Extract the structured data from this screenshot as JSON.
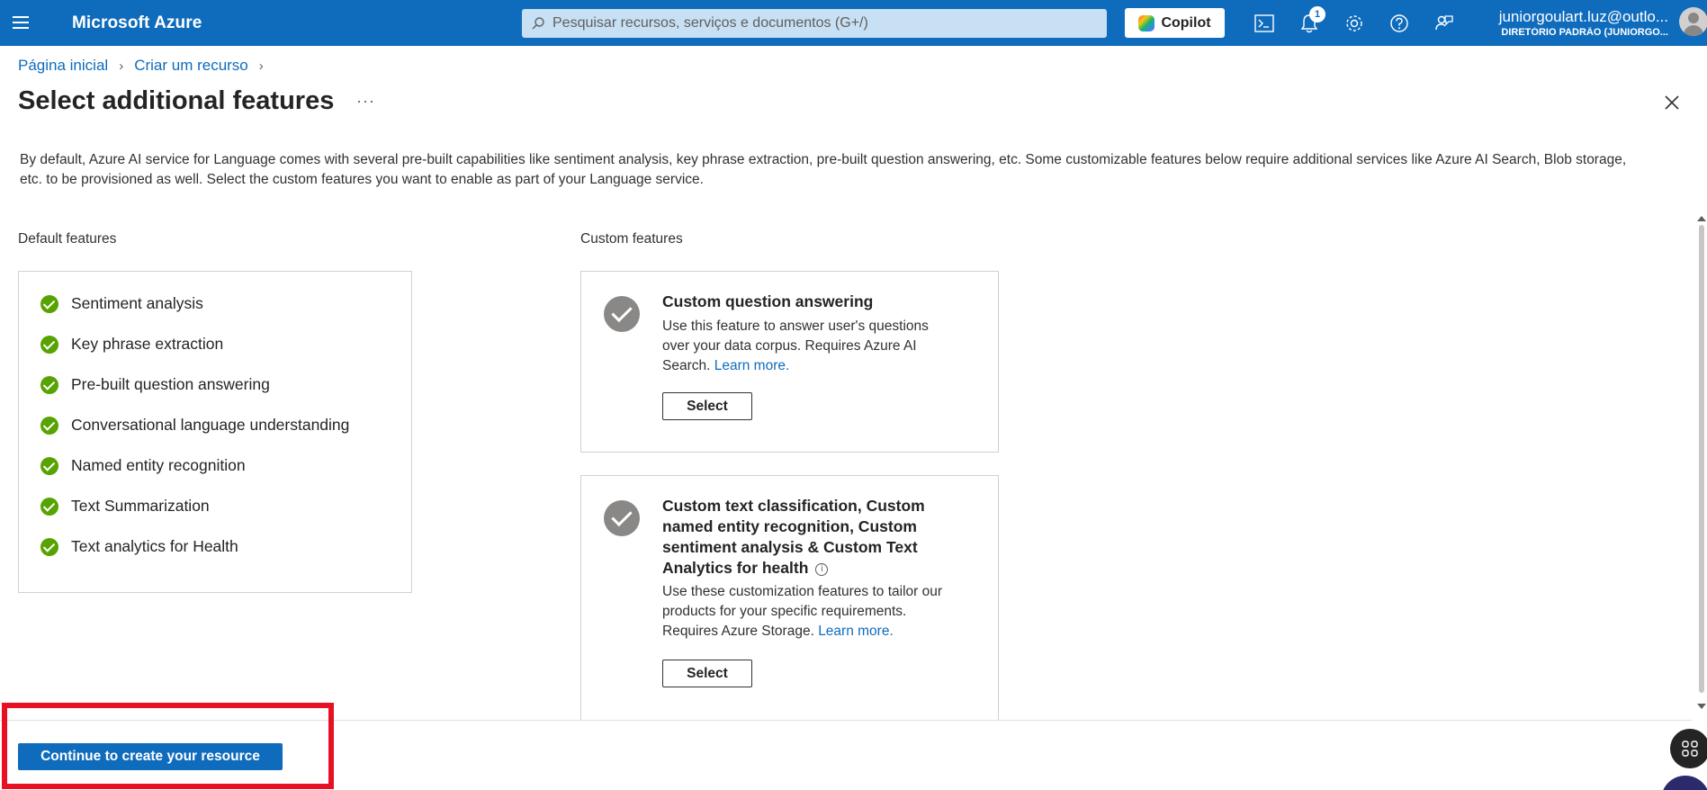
{
  "topbar": {
    "brand": "Microsoft Azure",
    "search_placeholder": "Pesquisar recursos, serviços e documentos (G+/)",
    "copilot_label": "Copilot",
    "notification_count": "1",
    "account_email": "juniorgoulart.luz@outlo...",
    "account_directory": "DIRETÓRIO PADRÃO (JUNIORGO..."
  },
  "breadcrumb": {
    "home": "Página inicial",
    "create": "Criar um recurso"
  },
  "page": {
    "title": "Select additional features",
    "more": "···",
    "description": "By default, Azure AI service for Language comes with several pre-built capabilities like sentiment analysis, key phrase extraction, pre-built question answering, etc. Some customizable features below require additional services like Azure AI Search, Blob storage, etc. to be provisioned as well. Select the custom features you want to enable as part of your Language service."
  },
  "default_features": {
    "label": "Default features",
    "items": [
      "Sentiment analysis",
      "Key phrase extraction",
      "Pre-built question answering",
      "Conversational language understanding",
      "Named entity recognition",
      "Text Summarization",
      "Text analytics for Health"
    ]
  },
  "custom_features": {
    "label": "Custom features",
    "cards": [
      {
        "title": "Custom question answering",
        "desc": "Use this feature to answer user's questions over your data corpus. Requires Azure AI Search.",
        "learn_more": "Learn more.",
        "button": "Select"
      },
      {
        "title": "Custom text classification, Custom named entity recognition, Custom sentiment analysis & Custom Text Analytics for health",
        "desc": "Use these customization features to tailor our products for your specific requirements. Requires Azure Storage.",
        "learn_more": "Learn more.",
        "button": "Select"
      }
    ]
  },
  "footer": {
    "continue_button": "Continue to create your resource"
  },
  "colors": {
    "accent": "#0f6cbd",
    "check_green": "#57a300",
    "highlight_red": "#e81123"
  }
}
